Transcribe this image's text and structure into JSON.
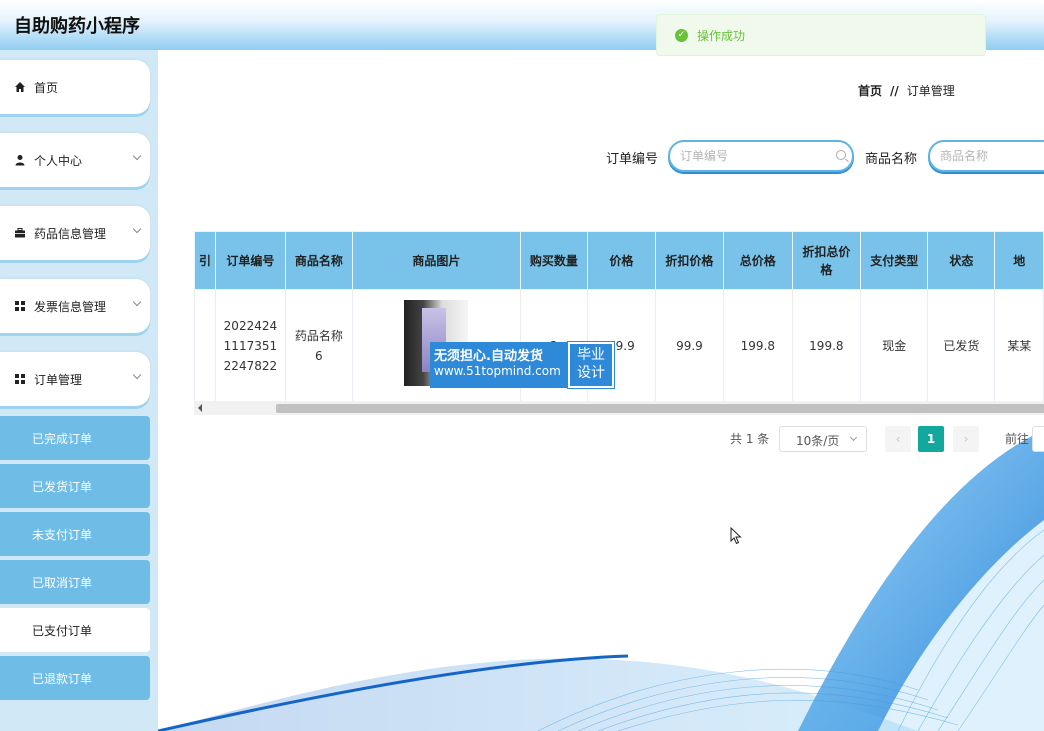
{
  "app": {
    "title": "自助购药小程序"
  },
  "toast": {
    "message": "操作成功"
  },
  "sidebar": {
    "items": [
      {
        "label": "首页",
        "icon": "home-icon"
      },
      {
        "label": "个人中心",
        "icon": "user-icon"
      },
      {
        "label": "药品信息管理",
        "icon": "briefcase-icon"
      },
      {
        "label": "发票信息管理",
        "icon": "grid-icon"
      },
      {
        "label": "订单管理",
        "icon": "grid-icon"
      }
    ],
    "sub_items": [
      {
        "label": "已完成订单",
        "active": false
      },
      {
        "label": "已发货订单",
        "active": false
      },
      {
        "label": "未支付订单",
        "active": false
      },
      {
        "label": "已取消订单",
        "active": false
      },
      {
        "label": "已支付订单",
        "active": true
      },
      {
        "label": "已退款订单",
        "active": false
      }
    ]
  },
  "breadcrumb": {
    "home": "首页",
    "separator": "//",
    "current": "订单管理"
  },
  "search": {
    "order_label": "订单编号",
    "order_placeholder": "订单编号",
    "product_label": "商品名称",
    "product_placeholder": "商品名称"
  },
  "table": {
    "columns": [
      "引",
      "订单编号",
      "商品名称",
      "商品图片",
      "购买数量",
      "价格",
      "折扣价格",
      "总价格",
      "折扣总价格",
      "支付类型",
      "状态",
      "地"
    ],
    "rows": [
      {
        "index": "",
        "order_no": "20224241117351224782 2",
        "order_no_lines": [
          "2022424",
          "1117351",
          "2247822"
        ],
        "product_name": "药品名称6",
        "product_name_lines": [
          "药品名称",
          "6"
        ],
        "quantity": "2",
        "price": "99.9",
        "discount_price": "99.9",
        "total_price": "199.8",
        "discount_total": "199.8",
        "pay_type": "现金",
        "status": "已发货",
        "address": "某某"
      }
    ]
  },
  "watermark": {
    "line1": "无须担心.自动发货",
    "line2": "www.51topmind.com",
    "right1": "毕业",
    "right2": "设计"
  },
  "pagination": {
    "total": "共 1 条",
    "page_size": "10条/页",
    "current_page": "1",
    "goto": "前往"
  },
  "colors": {
    "accent": "#13a89e",
    "header_blue": "#79c3ea",
    "sidebar_sub": "#6fbde6",
    "success": "#67c23a"
  }
}
